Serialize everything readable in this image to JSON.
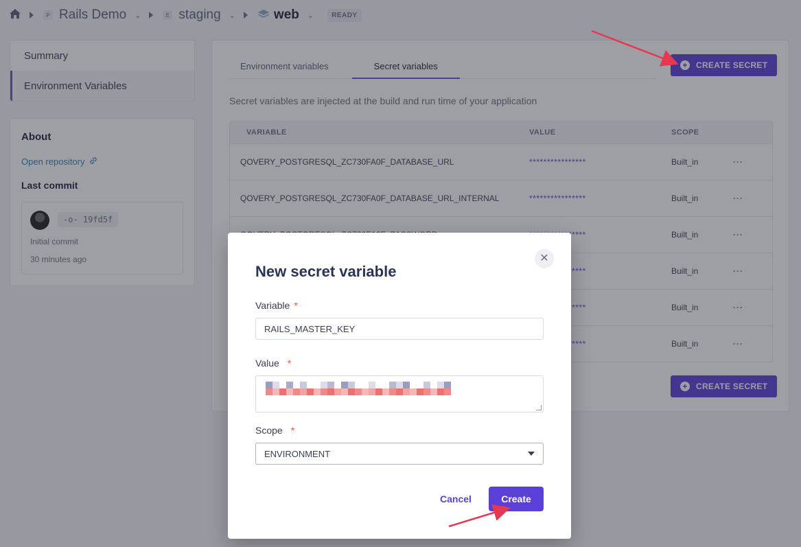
{
  "breadcrumb": {
    "project": {
      "badge": "P",
      "name": "Rails Demo"
    },
    "environment": {
      "badge": "E",
      "name": "staging"
    },
    "application": {
      "name": "web"
    },
    "status": "READY"
  },
  "sidebar": {
    "items": [
      {
        "label": "Summary"
      },
      {
        "label": "Environment Variables"
      }
    ]
  },
  "about": {
    "title": "About",
    "repo_link": "Open repository",
    "last_commit_title": "Last commit",
    "commit": {
      "hash": "19fd5f",
      "message": "Initial commit",
      "time": "30 minutes ago"
    }
  },
  "main": {
    "tabs": [
      {
        "label": "Environment variables"
      },
      {
        "label": "Secret variables"
      }
    ],
    "create_button_label": "CREATE SECRET",
    "description": "Secret variables are injected at the build and run time of your application",
    "table": {
      "headers": [
        "VARIABLE",
        "VALUE",
        "SCOPE"
      ],
      "rows": [
        {
          "variable": "QOVERY_POSTGRESQL_ZC730FA0F_DATABASE_URL",
          "value": "****************",
          "scope": "Built_in"
        },
        {
          "variable": "QOVERY_POSTGRESQL_ZC730FA0F_DATABASE_URL_INTERNAL",
          "value": "****************",
          "scope": "Built_in"
        },
        {
          "variable": "QOVERY_POSTGRESQL_ZC730FA0F_PASSWORD",
          "value": "****************",
          "scope": "Built_in"
        },
        {
          "variable": "",
          "value": "****************",
          "scope": "Built_in"
        },
        {
          "variable": "",
          "value": "****************",
          "scope": "Built_in"
        },
        {
          "variable": "",
          "value": "****************",
          "scope": "Built_in"
        }
      ],
      "more_label": "···"
    }
  },
  "modal": {
    "title": "New secret variable",
    "variable_label": "Variable",
    "variable_value": "RAILS_MASTER_KEY",
    "value_label": "Value",
    "scope_label": "Scope",
    "scope_value": "ENVIRONMENT",
    "required_marker": "*",
    "cancel_label": "Cancel",
    "submit_label": "Create"
  },
  "colors": {
    "accent": "#5b3fd6",
    "annotation_arrow": "#e8384f",
    "required": "#e8553a"
  },
  "icons": [
    "home-icon",
    "chevron-down-icon",
    "layers-icon",
    "link-icon",
    "commit-icon",
    "plus-circle-icon",
    "close-icon",
    "caret-down-icon"
  ]
}
